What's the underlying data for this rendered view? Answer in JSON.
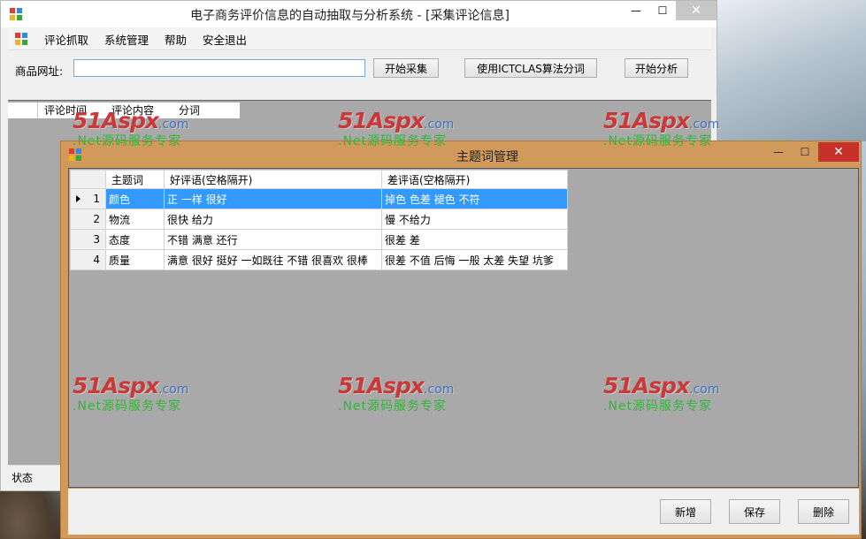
{
  "main_window": {
    "title": "电子商务评价信息的自动抽取与分析系统 - [采集评论信息]",
    "min_glyph": "—",
    "max_glyph": "☐",
    "close_glyph": "✕",
    "menu": [
      "评论抓取",
      "系统管理",
      "帮助",
      "安全退出"
    ],
    "url_label": "商品网址:",
    "url_value": "",
    "buttons": {
      "fetch": "开始采集",
      "split": "使用ICTCLAS算法分词",
      "analyze": "开始分析"
    },
    "grid_columns": [
      "评论时间",
      "评论内容",
      "分词"
    ],
    "status": "状态"
  },
  "dialog": {
    "title": "主题词管理",
    "min_glyph": "—",
    "max_glyph": "☐",
    "close_glyph": "✕",
    "columns": [
      "主题词",
      "好评语(空格隔开)",
      "差评语(空格隔开)"
    ],
    "rows": [
      {
        "index": "1",
        "topic": "颜色",
        "good": "正 一样 很好",
        "bad": "掉色 色差 褪色 不符",
        "selected": true
      },
      {
        "index": "2",
        "topic": "物流",
        "good": "很快 给力",
        "bad": "慢 不给力",
        "selected": false
      },
      {
        "index": "3",
        "topic": "态度",
        "good": "不错 满意 还行",
        "bad": "很差 差",
        "selected": false
      },
      {
        "index": "4",
        "topic": "质量",
        "good": "满意 很好 挺好 一如既往 不错 很喜欢 很棒",
        "bad": "很差 不值 后悔 一般 太差 失望 坑爹",
        "selected": false
      }
    ],
    "buttons": {
      "add": "新增",
      "save": "保存",
      "delete": "删除"
    }
  },
  "watermark": {
    "logo": "51Aspx",
    "suffix": ".com",
    "tagline": ".Net源码服务专家"
  },
  "colors": {
    "selection": "#3399ff",
    "dialog_frame": "#d29a5a",
    "grid_background": "#a9a9a9",
    "close_button": "#c7302b"
  }
}
